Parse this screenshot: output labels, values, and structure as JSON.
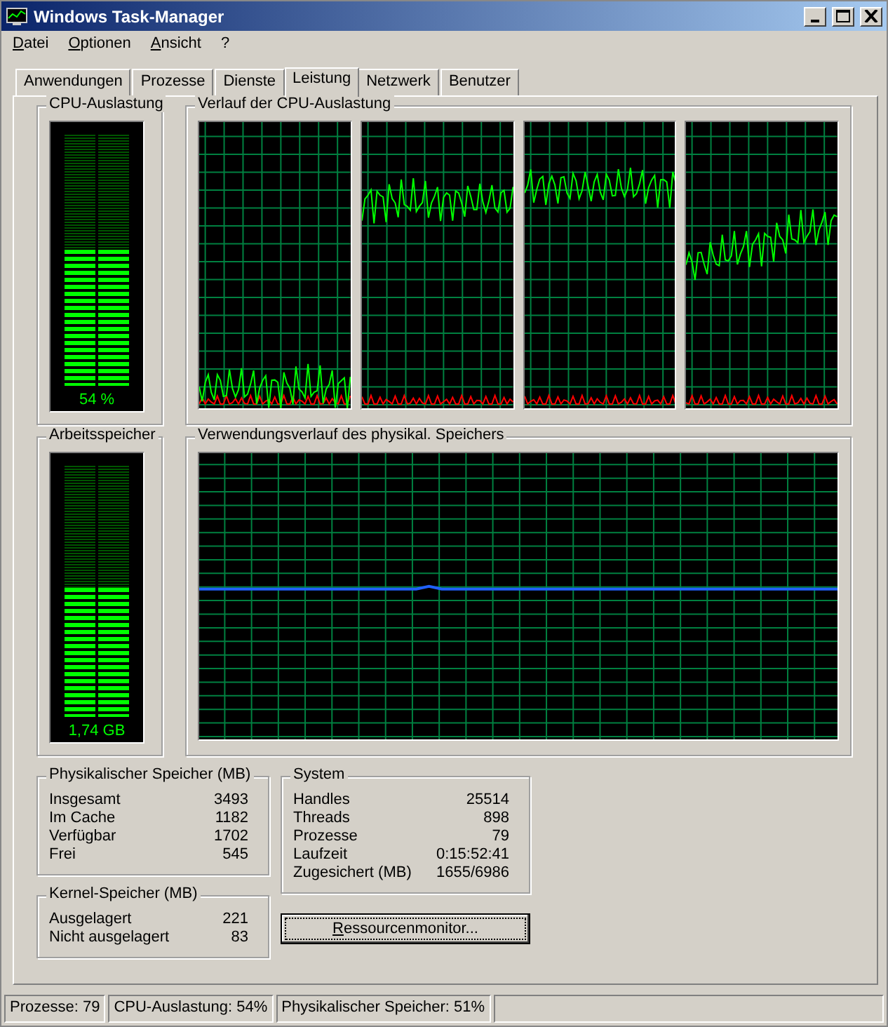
{
  "window": {
    "title": "Windows Task-Manager"
  },
  "menu": [
    {
      "label": "Datei"
    },
    {
      "label": "Optionen"
    },
    {
      "label": "Ansicht"
    },
    {
      "label": "?"
    }
  ],
  "tabs": [
    {
      "label": "Anwendungen",
      "selected": false
    },
    {
      "label": "Prozesse",
      "selected": false
    },
    {
      "label": "Dienste",
      "selected": false
    },
    {
      "label": "Leistung",
      "selected": true
    },
    {
      "label": "Netzwerk",
      "selected": false
    },
    {
      "label": "Benutzer",
      "selected": false
    }
  ],
  "cpu_usage": {
    "label": "CPU-Auslastung",
    "level": 0.54,
    "reading": "54 %"
  },
  "cpu_history": {
    "label": "Verlauf der CPU-Auslastung"
  },
  "memory_usage": {
    "label": "Arbeitsspeicher",
    "level": 0.51,
    "reading": "1,74 GB"
  },
  "memory_history": {
    "label": "Verwendungsverlauf des physikal. Speichers"
  },
  "physical_memory": {
    "title": "Physikalischer Speicher (MB)",
    "rows": [
      {
        "label": "Insgesamt",
        "value": "3493"
      },
      {
        "label": "Im Cache",
        "value": "1182"
      },
      {
        "label": "Verfügbar",
        "value": "1702"
      },
      {
        "label": "Frei",
        "value": "545"
      }
    ]
  },
  "kernel_memory": {
    "title": "Kernel-Speicher (MB)",
    "rows": [
      {
        "label": "Ausgelagert",
        "value": "221"
      },
      {
        "label": "Nicht ausgelagert",
        "value": "83"
      }
    ]
  },
  "system": {
    "title": "System",
    "rows": [
      {
        "label": "Handles",
        "value": "25514"
      },
      {
        "label": "Threads",
        "value": "898"
      },
      {
        "label": "Prozesse",
        "value": "79"
      },
      {
        "label": "Laufzeit",
        "value": "0:15:52:41"
      },
      {
        "label": "Zugesichert (MB)",
        "value": "1655/6986"
      }
    ]
  },
  "button": {
    "label": "Ressourcenmonitor..."
  },
  "status_bar": [
    "Prozesse: 79",
    "CPU-Auslastung: 54%",
    "Physikalischer Speicher: 51%"
  ]
}
